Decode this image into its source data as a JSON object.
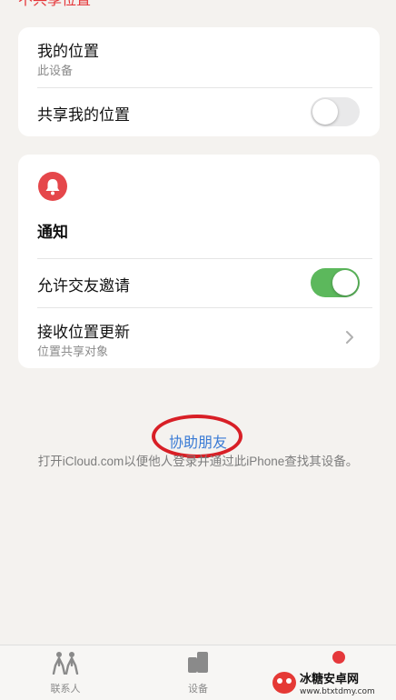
{
  "top_cut_text": "不共享位置",
  "location_card": {
    "my_location_title": "我的位置",
    "my_location_sub": "此设备",
    "share_label": "共享我的位置",
    "share_enabled": false
  },
  "notify_card": {
    "heading": "通知",
    "allow_invites_label": "允许交友邀请",
    "allow_invites_enabled": true,
    "receive_updates_title": "接收位置更新",
    "receive_updates_sub": "位置共享对象"
  },
  "help": {
    "link": "协助朋友",
    "description": "打开iCloud.com以便他人登录并通过此iPhone查找其设备。"
  },
  "tabs": [
    {
      "label": "联系人",
      "icon": "people-icon"
    },
    {
      "label": "设备",
      "icon": "devices-icon"
    }
  ],
  "watermark": {
    "title": "冰糖安卓网",
    "url": "www.btxtdmy.com"
  },
  "colors": {
    "accent_blue": "#3a7bd5",
    "toggle_on": "#5cb85c",
    "bell_red": "#e5474b",
    "annotation_red": "#d81f26"
  }
}
